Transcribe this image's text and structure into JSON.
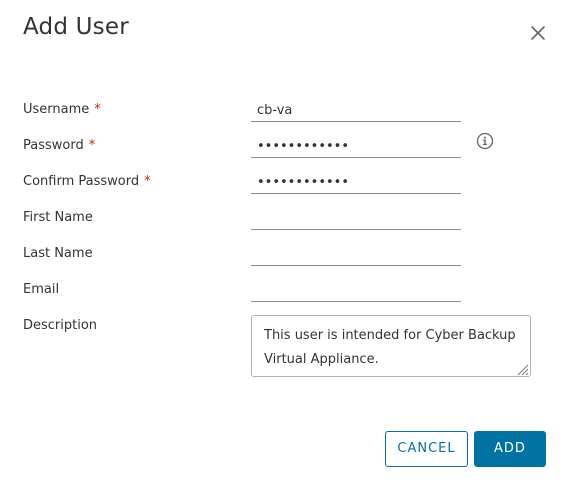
{
  "dialog": {
    "title": "Add User",
    "close_icon": "close-icon"
  },
  "form": {
    "username": {
      "label": "Username",
      "required_mark": "*",
      "value": "cb-va"
    },
    "password": {
      "label": "Password",
      "required_mark": "*",
      "value": "••••••••••••",
      "info_icon": "info-circle-icon"
    },
    "confirm_password": {
      "label": "Confirm Password",
      "required_mark": "*",
      "value": "••••••••••••"
    },
    "first_name": {
      "label": "First Name",
      "value": ""
    },
    "last_name": {
      "label": "Last Name",
      "value": ""
    },
    "email": {
      "label": "Email",
      "value": ""
    },
    "description": {
      "label": "Description",
      "value": "This user is intended for Cyber Backup Virtual Appliance."
    }
  },
  "actions": {
    "cancel_label": "CANCEL",
    "add_label": "ADD"
  },
  "colors": {
    "primary": "#0072a3",
    "required": "#c92100",
    "text": "#333333"
  }
}
